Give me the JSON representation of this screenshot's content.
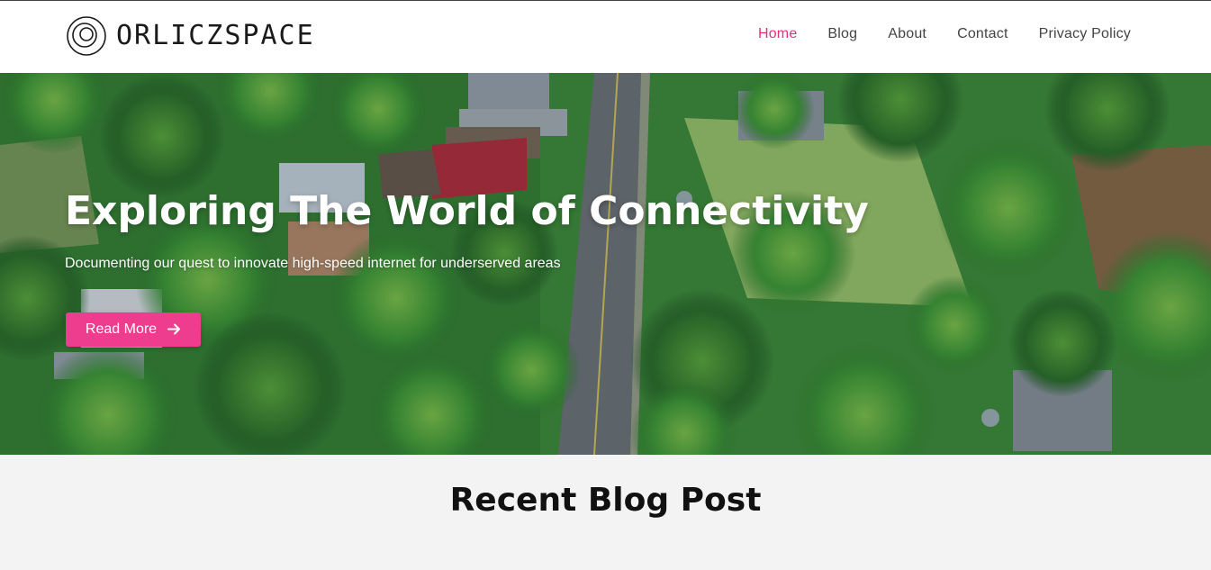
{
  "brand": {
    "name": "ORLICZSPACE",
    "logo_icon": "concentric-circles-logo-icon"
  },
  "nav": {
    "items": [
      {
        "label": "Home",
        "active": true
      },
      {
        "label": "Blog",
        "active": false
      },
      {
        "label": "About",
        "active": false
      },
      {
        "label": "Contact",
        "active": false
      },
      {
        "label": "Privacy Policy",
        "active": false
      }
    ]
  },
  "hero": {
    "title": "Exploring The World of Connectivity",
    "subtitle": "Documenting our quest to innovate high-speed internet for underserved areas",
    "button_label": "Read More",
    "button_icon": "arrow-right-icon",
    "background": "aerial-road-palm-trees-image"
  },
  "recent": {
    "title": "Recent Blog Post"
  },
  "colors": {
    "accent": "#e0317f",
    "button": "#ee3c8f",
    "header_bg": "#ffffff",
    "section_bg": "#f3f3f3"
  }
}
